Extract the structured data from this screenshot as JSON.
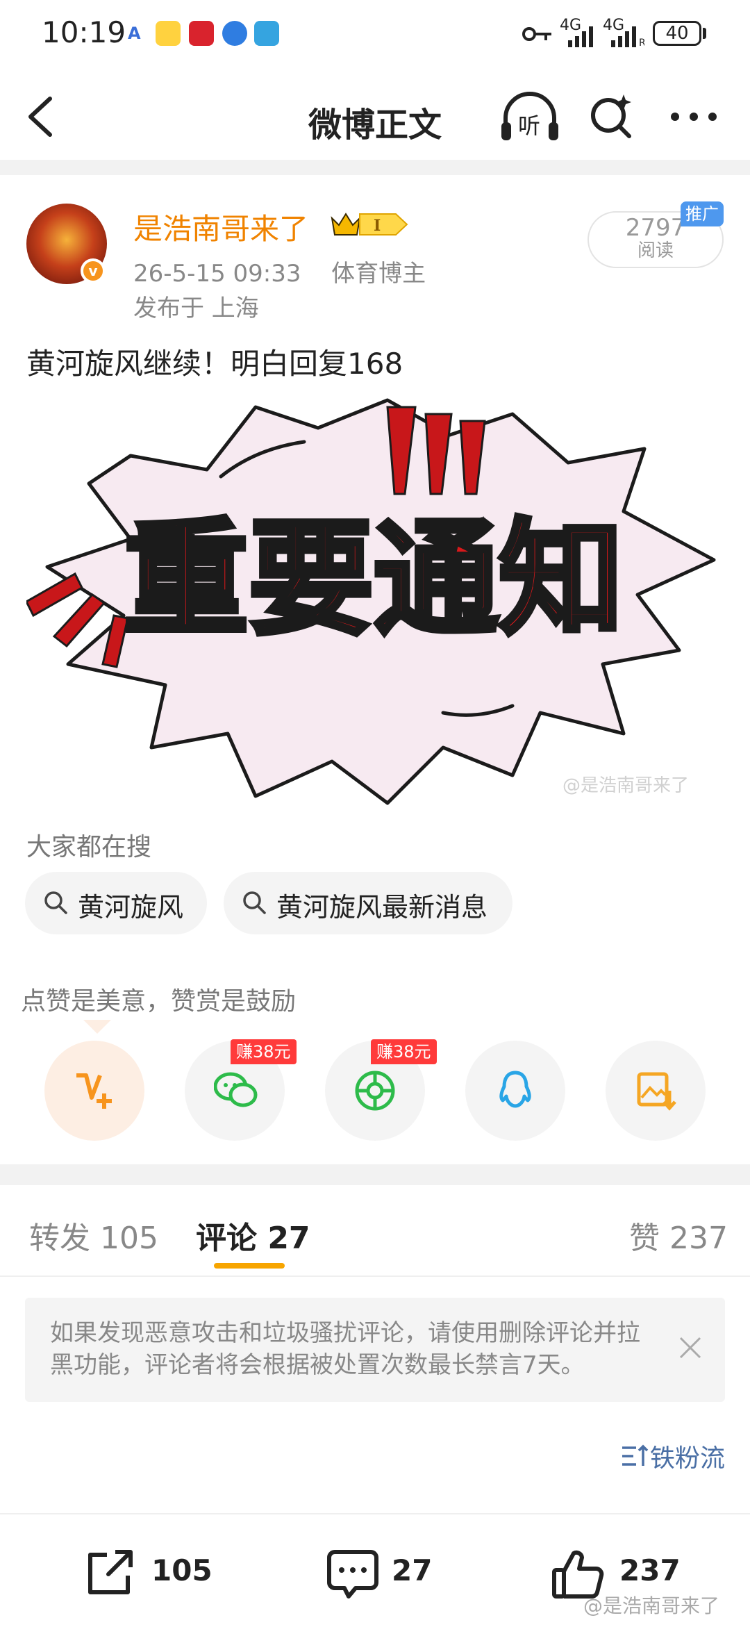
{
  "status_bar": {
    "time": "10:19",
    "network_left": "4G",
    "network_right": "4G",
    "battery": "40",
    "icons": [
      "font-icon",
      "weibo-icon",
      "news-app-icon",
      "check-app-icon",
      "telegram-icon",
      "key-icon",
      "signal-icon",
      "battery-icon"
    ]
  },
  "nav": {
    "title": "微博正文",
    "back_icon": "back-arrow-icon",
    "listen_label": "听",
    "search_icon": "search-sparkle-icon",
    "more_icon": "more-icon"
  },
  "post": {
    "author": "是浩南哥来了",
    "vip_level": "I",
    "date": "26-5-15 09:33",
    "category": "体育博主",
    "location": "发布于 上海",
    "read_count": "2797",
    "read_label": "阅读",
    "ad_tag": "推广",
    "text": "黄河旋风继续！明白回复168",
    "image": {
      "headline": "重要通知",
      "exclamations": "!!!",
      "watermark": "@是浩南哥来了"
    }
  },
  "search": {
    "title": "大家都在搜",
    "chips": [
      "黄河旋风",
      "黄河旋风最新消息"
    ]
  },
  "reward": {
    "title": "点赞是美意，赞赏是鼓励",
    "earn_label": "赚38元",
    "buttons": [
      "reward-v-icon",
      "wechat-icon",
      "moments-icon",
      "qq-icon",
      "save-image-icon"
    ]
  },
  "tabs": {
    "repost": "转发 105",
    "comment": "评论 27",
    "like": "赞 237"
  },
  "notice": {
    "text": "如果发现恶意攻击和垃圾骚扰评论，请使用删除评论并拉黑功能，评论者将会根据被处置次数最长禁言7天。"
  },
  "sort": {
    "label": "铁粉流"
  },
  "bottom_bar": {
    "repost_count": "105",
    "comment_count": "27",
    "like_count": "237",
    "watermark": "@是浩南哥来了"
  },
  "colors": {
    "accent_orange": "#f08300",
    "tab_underline": "#f7a500",
    "ad_blue": "#4e98ee",
    "earn_red": "#ff3a3a",
    "headline_red": "#d7191b"
  }
}
